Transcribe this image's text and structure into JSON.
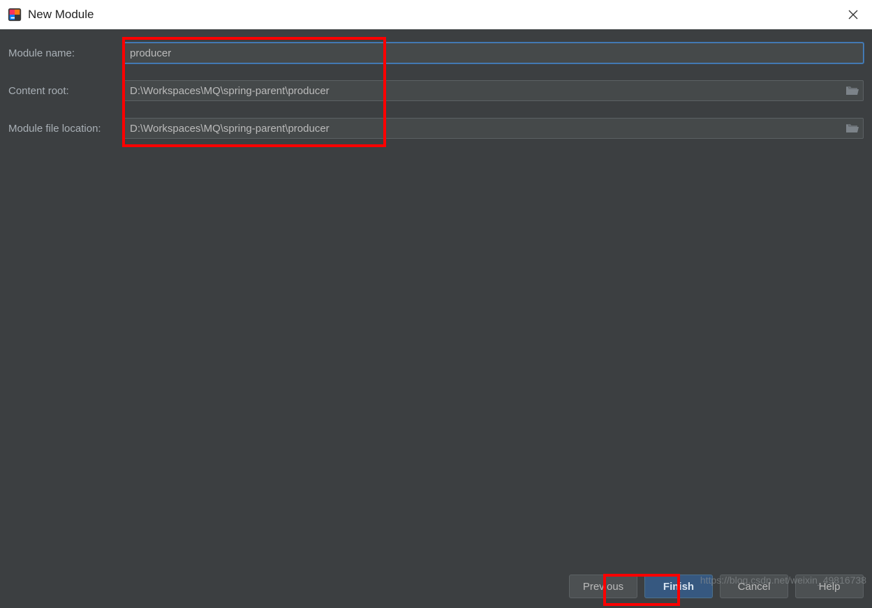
{
  "window": {
    "title": "New Module"
  },
  "form": {
    "module_name_label": "Module name:",
    "module_name_value": "producer",
    "content_root_label": "Content root:",
    "content_root_value": "D:\\Workspaces\\MQ\\spring-parent\\producer",
    "module_file_label": "Module file location:",
    "module_file_value": "D:\\Workspaces\\MQ\\spring-parent\\producer"
  },
  "buttons": {
    "previous": "Previous",
    "finish": "Finish",
    "cancel": "Cancel",
    "help": "Help"
  },
  "watermark": "https://blog.csdn.net/weixin_49816738"
}
